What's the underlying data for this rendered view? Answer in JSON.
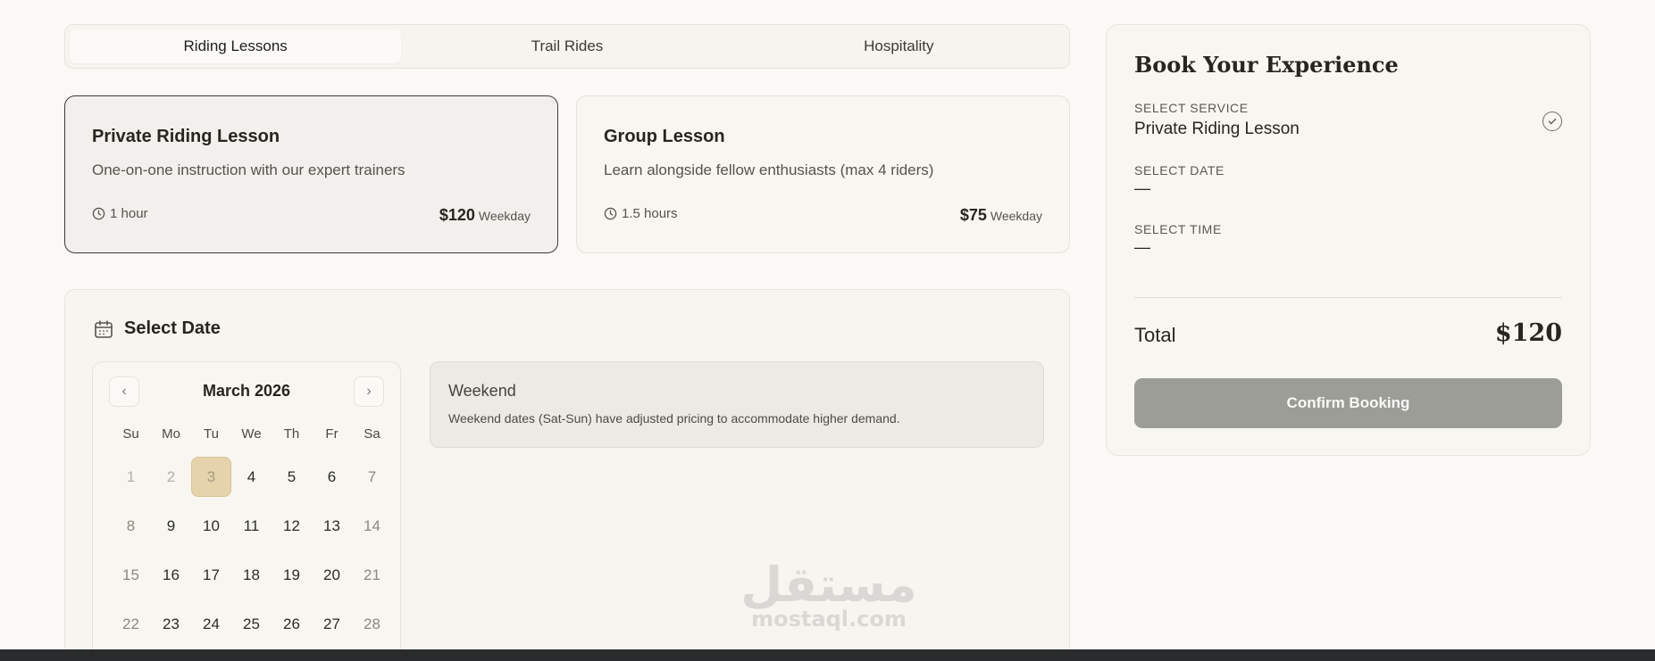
{
  "tabs": [
    "Riding Lessons",
    "Trail Rides",
    "Hospitality"
  ],
  "services": [
    {
      "title": "Private Riding Lesson",
      "description": "One-on-one instruction with our expert trainers",
      "duration": "1 hour",
      "price": "$120",
      "price_note": "Weekday"
    },
    {
      "title": "Group Lesson",
      "description": "Learn alongside fellow enthusiasts (max 4 riders)",
      "duration": "1.5 hours",
      "price": "$75",
      "price_note": "Weekday"
    }
  ],
  "date_section": {
    "title": "Select Date"
  },
  "calendar": {
    "month": "March 2026",
    "prev": "‹",
    "next": "›",
    "weekdays": [
      "Su",
      "Mo",
      "Tu",
      "We",
      "Th",
      "Fr",
      "Sa"
    ],
    "days": [
      "1",
      "2",
      "3",
      "4",
      "5",
      "6",
      "7",
      "8",
      "9",
      "10",
      "11",
      "12",
      "13",
      "14",
      "15",
      "16",
      "17",
      "18",
      "19",
      "20",
      "21",
      "22",
      "23",
      "24",
      "25",
      "26",
      "27",
      "28"
    ]
  },
  "weekend_note": {
    "title": "Weekend",
    "text": "Weekend dates (Sat-Sun) have adjusted pricing to accommodate higher demand."
  },
  "booking": {
    "title": "Book Your Experience",
    "service_label": "SELECT SERVICE",
    "service_value": "Private Riding Lesson",
    "date_label": "SELECT DATE",
    "date_value": "—",
    "time_label": "SELECT TIME",
    "time_value": "—",
    "total_label": "Total",
    "total_value": "$120",
    "confirm_label": "Confirm Booking"
  },
  "watermark": {
    "arabic": "مستقل",
    "latin": "mostaql.com"
  }
}
